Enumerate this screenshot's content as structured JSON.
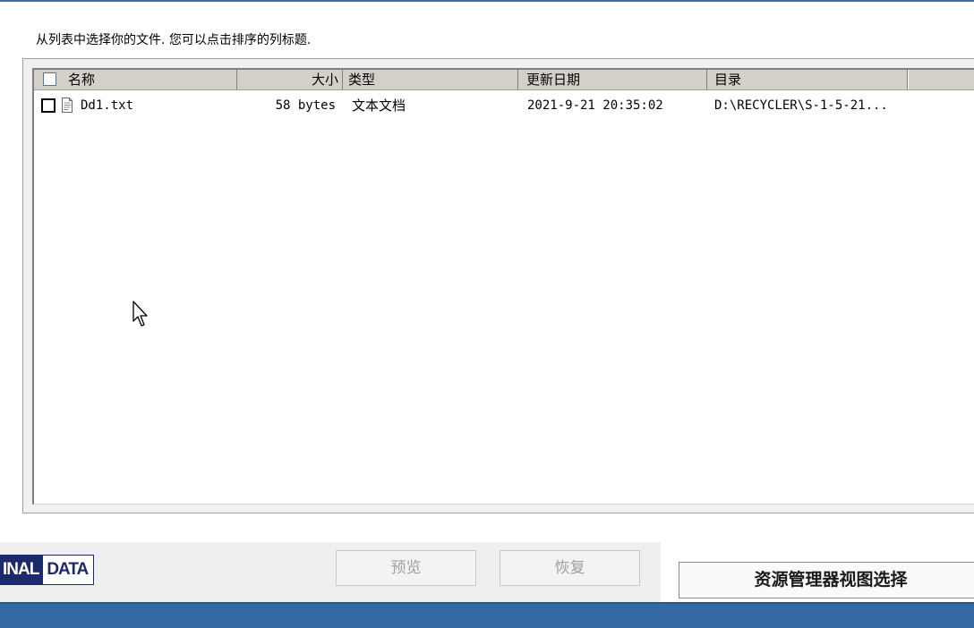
{
  "instruction": "从列表中选择你的文件. 您可以点击排序的列标题.",
  "columns": {
    "name": "名称",
    "size": "大小",
    "type": "类型",
    "date": "更新日期",
    "dir": "目录"
  },
  "files": [
    {
      "name": "Dd1.txt",
      "size": "58 bytes",
      "type": "文本文档",
      "date": "2021-9-21 20:35:02",
      "dir": "D:\\RECYCLER\\S-1-5-21...",
      "checked": false,
      "icon": "text-file-icon"
    }
  ],
  "logo": {
    "part1": "INAL",
    "part2": "DATA",
    "color": "#1d2a6a"
  },
  "buttons": {
    "preview": "预览",
    "restore": "恢复",
    "explorer": "资源管理器视图选择"
  },
  "colors": {
    "taskbar": "#336aa6",
    "header": "#d4d0c8",
    "checkbox_border": "#3b78c9"
  }
}
